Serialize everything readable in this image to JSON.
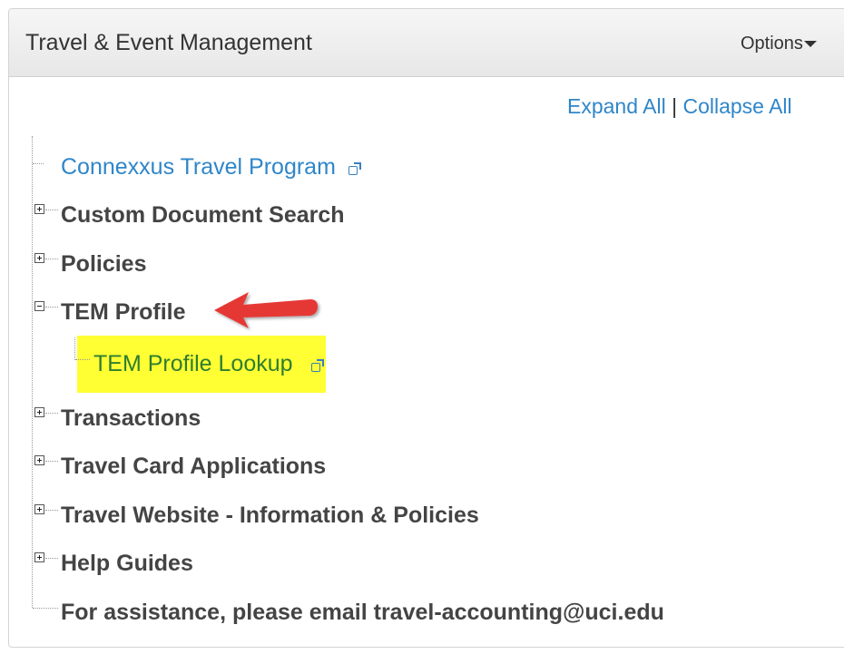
{
  "header": {
    "title": "Travel & Event Management",
    "options_label": "Options"
  },
  "toolbar": {
    "expand_all": "Expand All",
    "separator": "|",
    "collapse_all": "Collapse All"
  },
  "tree": {
    "items": [
      {
        "label": "Connexxus Travel Program",
        "type": "link",
        "expander": "none",
        "external": true
      },
      {
        "label": "Custom Document Search",
        "type": "folder",
        "expander": "plus"
      },
      {
        "label": "Policies",
        "type": "folder",
        "expander": "plus"
      },
      {
        "label": "TEM Profile",
        "type": "folder",
        "expander": "minus"
      },
      {
        "label": "TEM Profile Lookup",
        "type": "link",
        "expander": "none",
        "external": true,
        "highlighted": true,
        "level": 2
      },
      {
        "label": "Transactions",
        "type": "folder",
        "expander": "plus"
      },
      {
        "label": "Travel Card Applications",
        "type": "folder",
        "expander": "plus"
      },
      {
        "label": "Travel Website - Information & Policies",
        "type": "folder",
        "expander": "plus"
      },
      {
        "label": "Help Guides",
        "type": "folder",
        "expander": "plus"
      },
      {
        "label": "For assistance, please email travel-accounting@uci.edu",
        "type": "text",
        "expander": "none"
      }
    ]
  },
  "annotation": {
    "arrow_color": "#e53935",
    "highlight_color": "#ffff33"
  },
  "colors": {
    "link": "#2f86c9",
    "sub_link": "#2e7d32",
    "text": "#444444"
  }
}
